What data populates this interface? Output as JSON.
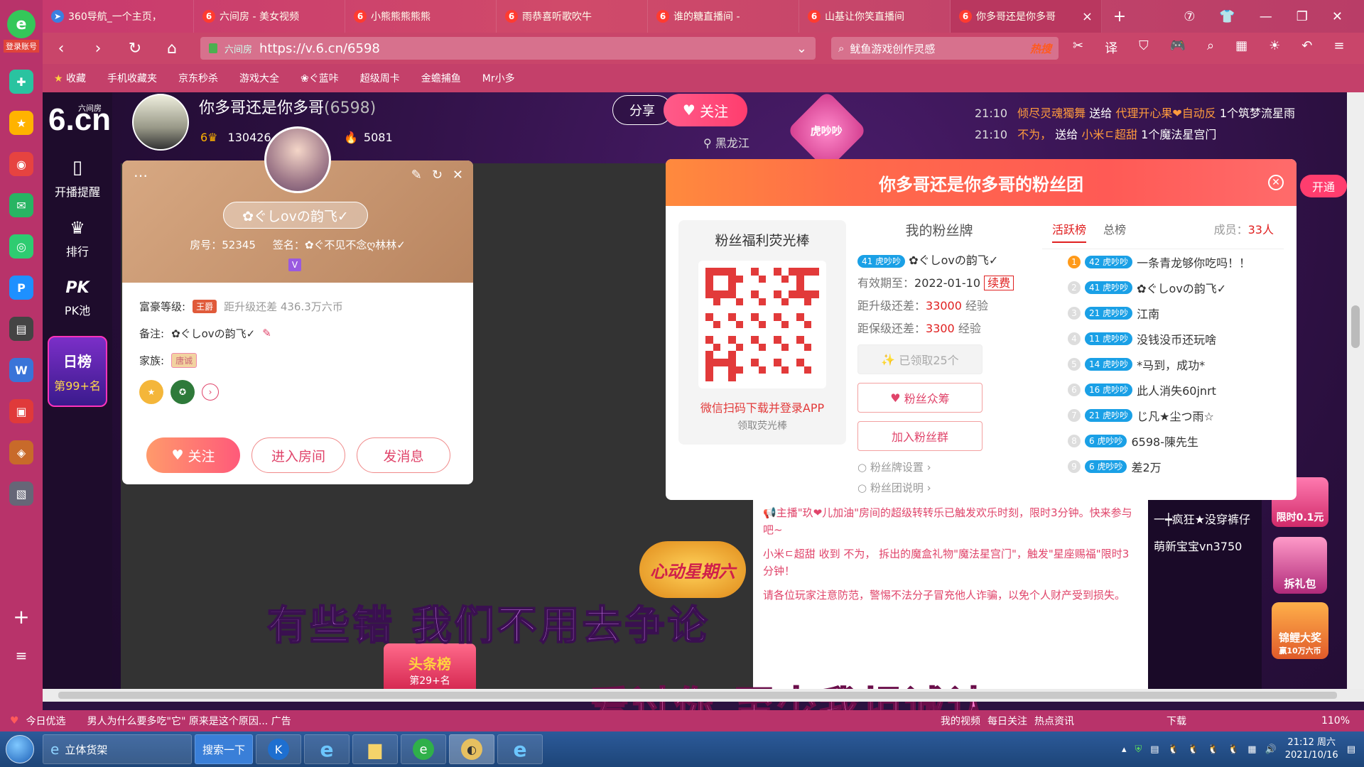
{
  "browser": {
    "tabs": [
      {
        "title": "360导航_一个主页，"
      },
      {
        "title": "六间房 - 美女视频"
      },
      {
        "title": "小熊熊熊熊熊"
      },
      {
        "title": "雨恭喜听歌吹牛"
      },
      {
        "title": "谁的糖直播间 -"
      },
      {
        "title": "山基让你笑直播间"
      },
      {
        "title": "你多哥还是你多哥"
      }
    ],
    "url": "https://v.6.cn/6598",
    "url_label": "六间房",
    "search_text": "鱿鱼游戏创作灵感",
    "search_hot": "热搜",
    "sidebar_login": "登录账号",
    "bookmarks": [
      "收藏",
      "手机收藏夹",
      "京东秒杀",
      "游戏大全",
      "❀ぐ蓝咔",
      "超级周卡",
      "金蟾捕鱼",
      "Mr小多"
    ]
  },
  "site": {
    "logo": "6.cn",
    "logo_sub": "六间房",
    "nav": [
      {
        "label": "开播提醒"
      },
      {
        "label": "排行"
      },
      {
        "label": "PK池"
      }
    ],
    "daily_rank_title": "日榜",
    "daily_rank_value": "第99+名"
  },
  "anchor": {
    "name": "你多哥还是你多哥",
    "room_id": "(6598)",
    "level_value": "130426",
    "fans_value": "5081",
    "location": "黑龙江",
    "share_label": "分享",
    "follow_label": "关注",
    "badge": "虎吵吵"
  },
  "gift_messages": [
    {
      "time": "21:10",
      "from": "倾尽灵魂獨舞",
      "action": "送给",
      "to": "代理开心果❤自动反",
      "gift": "1个筑梦流星雨"
    },
    {
      "time": "21:10",
      "from": "不为，",
      "action": "送给",
      "to": "小米ㄷ超甜",
      "gift": "1个魔法星宫门"
    }
  ],
  "user_card": {
    "nickname": "✿ぐしovの韵飞✓",
    "room_no_label": "房号：",
    "room_no": "52345",
    "sign_label": "签名：",
    "sign": "✿ぐ不见不念ღ林林✓",
    "wealth_label": "富豪等级:",
    "wealth_badge": "王爵",
    "wealth_next": "距升级还差 436.3万六币",
    "remark_label": "备注:",
    "remark": "✿ぐしovの韵飞✓",
    "family_label": "家族:",
    "family_badge": "唐诚",
    "buttons": {
      "follow": "关注",
      "enter": "进入房间",
      "message": "发消息"
    }
  },
  "fan_club": {
    "title": "你多哥还是你多哥的粉丝团",
    "open_label": "开通",
    "qr_title": "粉丝福利荧光棒",
    "qr_download": "微信扫码下载并登录APP",
    "qr_sub": "领取荧光棒",
    "my_badge_title": "我的粉丝牌",
    "my_badge_level": "41",
    "my_badge_name": "虎吵吵",
    "my_badge_user": "✿ぐしovの韵飞✓",
    "expiry_label": "有效期至：",
    "expiry": "2022-01-10",
    "renew": "续费",
    "upgrade_label": "距升级还差：",
    "upgrade_value": "33000",
    "upgrade_unit": "经验",
    "keep_label": "距保级还差：",
    "keep_value": "3300",
    "keep_unit": "经验",
    "claimed": "已领取25个",
    "crowdfund": "粉丝众筹",
    "join_group": "加入粉丝群",
    "settings": "粉丝牌设置 ›",
    "help": "粉丝团说明 ›",
    "tab_active": "活跃榜",
    "tab_total": "总榜",
    "member_label": "成员：",
    "member_count": "33人",
    "ranking": [
      {
        "no": "1",
        "level": "42",
        "name": "一条青龙够你吃吗！！"
      },
      {
        "no": "2",
        "level": "41",
        "name": "✿ぐしovの韵飞✓"
      },
      {
        "no": "3",
        "level": "21",
        "name": "江南"
      },
      {
        "no": "4",
        "level": "11",
        "name": "没钱没币还玩啥"
      },
      {
        "no": "5",
        "level": "14",
        "name": "*马到，成功*"
      },
      {
        "no": "6",
        "level": "16",
        "name": "此人消失60jnrt"
      },
      {
        "no": "7",
        "level": "21",
        "name": "じ凡★尘つ雨☆"
      },
      {
        "no": "8",
        "level": "6",
        "name": "6598-陳先生"
      },
      {
        "no": "9",
        "level": "6",
        "name": "差2万"
      }
    ]
  },
  "chat": [
    "主播\"玖❤儿加油\"房间的超级转转乐已触发欢乐时刻，限时3分钟。快来参与吧~",
    "小米ㄷ超甜 收到 不为， 拆出的魔盒礼物\"魔法星宫门\"，触发\"星座赐福\"限时3分钟！",
    "请各位玩家注意防范，警惕不法分子冒充他人诈骗，以免个人财产受到损失。"
  ],
  "right_panel": {
    "items": [
      "一┿疯狂★没穿裤仔",
      "萌新宝宝vn3750"
    ],
    "promo1": "限时0.1元",
    "promo2": "拆礼包",
    "promo3": "锦鲤大奖",
    "promo3_sub": "赢10万六币",
    "promo_hearts": "心动星期六",
    "headline": "头条榜",
    "headline_rank": "第29+名"
  },
  "subtitles": {
    "line1": "有些错   我们不用去争论",
    "line2": "爱过你   至少我坦诚认"
  },
  "statusbar": {
    "item1": "今日优选",
    "news": "男人为什么要多吃\"它\" 原来是这个原因... 广告",
    "links": [
      "我的视频",
      "每日关注",
      "热点资讯",
      "下载"
    ],
    "zoom": "110%"
  },
  "taskbar": {
    "app1": "立体货架",
    "search_btn": "搜索一下",
    "time": "21:12 周六",
    "date": "2021/10/16"
  },
  "colors": {
    "accent": "#e0446a",
    "browser": "#c9456a",
    "fanclub_header": "#ff6a4a"
  }
}
